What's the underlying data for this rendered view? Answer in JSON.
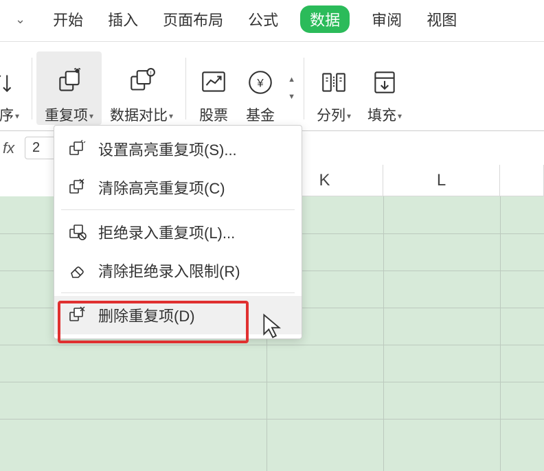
{
  "tabs": {
    "start": "开始",
    "insert": "插入",
    "layout": "页面布局",
    "formula": "公式",
    "data": "数据",
    "review": "审阅",
    "view": "视图"
  },
  "ribbon": {
    "sort": "序",
    "duplicates": "重复项",
    "compare": "数据对比",
    "stock": "股票",
    "fund": "基金",
    "split": "分列",
    "fill": "填充"
  },
  "formula_bar": {
    "fx": "fx",
    "value": "2"
  },
  "columns": {
    "k": "K",
    "l": "L"
  },
  "dropdown": {
    "set_highlight": "设置高亮重复项(S)...",
    "clear_highlight": "清除高亮重复项(C)",
    "refuse_input": "拒绝录入重复项(L)...",
    "clear_refuse": "清除拒绝录入限制(R)",
    "delete_dup": "删除重复项(D)"
  }
}
